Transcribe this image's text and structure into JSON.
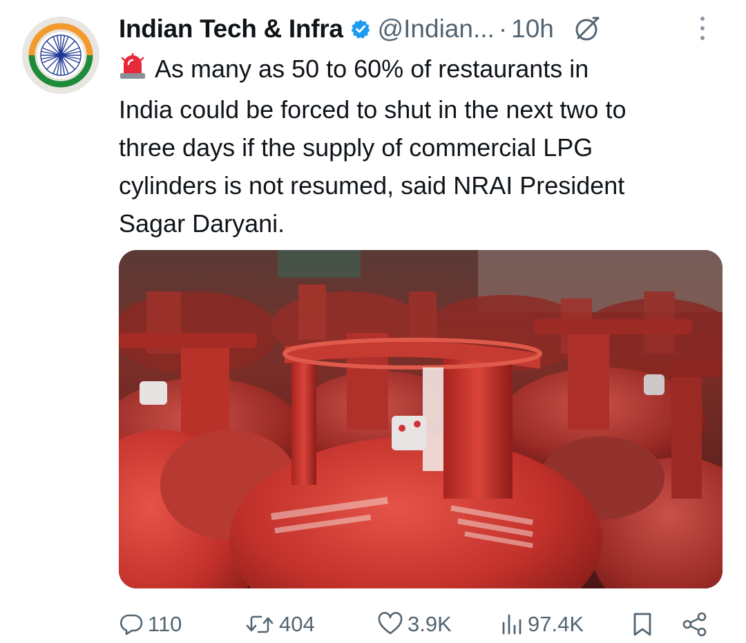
{
  "author": {
    "display_name": "Indian Tech & Infra",
    "handle": "@Indian...",
    "separator": "·",
    "time": "10h",
    "verified": true,
    "avatar_icon": "india-flag-chakra-icon"
  },
  "tweet": {
    "emoji_icon": "siren-icon",
    "lines": [
      "As many as 50 to 60% of restaurants in",
      "India could be forced to shut in the next two to",
      "three days if the supply of commercial LPG",
      "cylinders is not resumed, said NRAI President",
      "Sagar Daryani."
    ]
  },
  "media": {
    "icon": "lpg-cylinders-photo"
  },
  "actions": {
    "replies": "110",
    "reposts": "404",
    "likes": "3.9K",
    "views": "97.4K"
  },
  "colors": {
    "text": "#0f1419",
    "secondary": "#536471",
    "verified": "#1d9bf0",
    "saffron": "#f29a2e",
    "green": "#1e8a3a",
    "chakra": "#1f3a93"
  }
}
